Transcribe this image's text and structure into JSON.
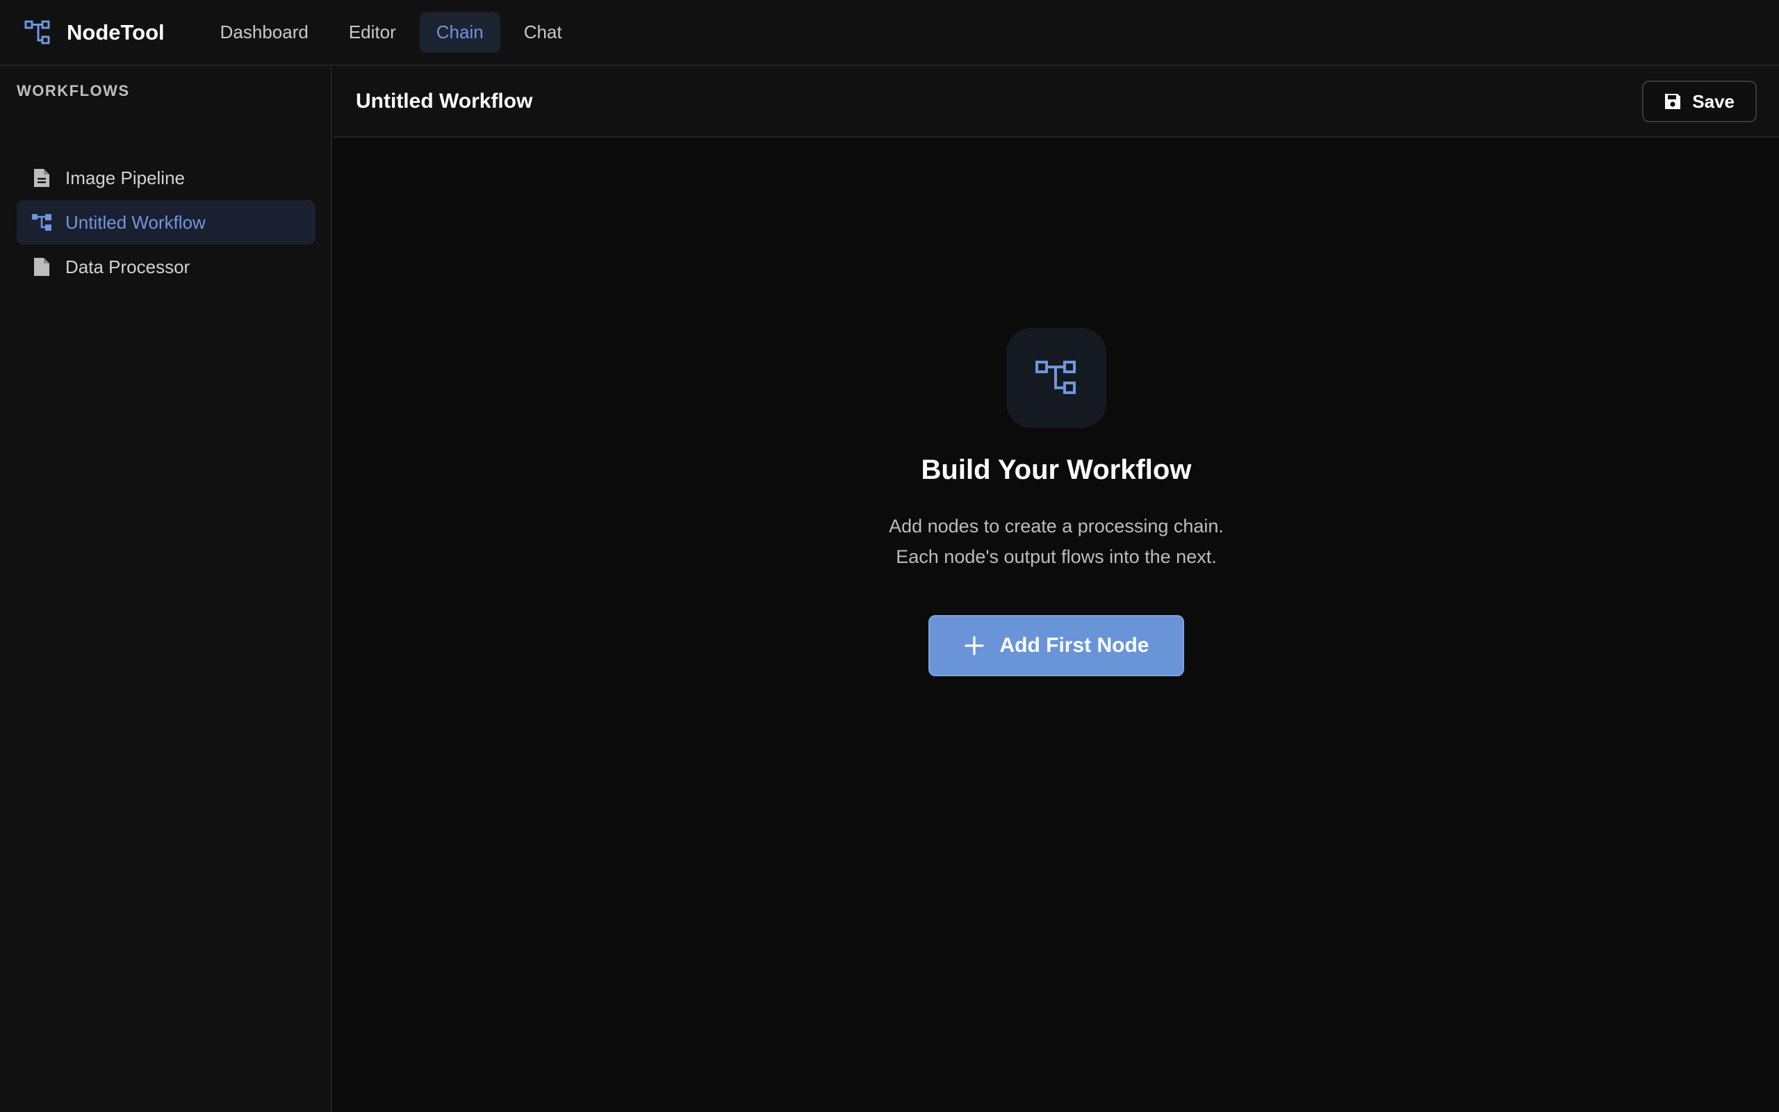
{
  "app": {
    "name": "NodeTool"
  },
  "nav": [
    {
      "label": "Dashboard",
      "active": false
    },
    {
      "label": "Editor",
      "active": false
    },
    {
      "label": "Chain",
      "active": true
    },
    {
      "label": "Chat",
      "active": false
    }
  ],
  "sidebar": {
    "section_title": "WORKFLOWS",
    "items": [
      {
        "label": "Image Pipeline",
        "icon": "file-text-icon",
        "active": false
      },
      {
        "label": "Untitled Workflow",
        "icon": "workflow-icon",
        "active": true
      },
      {
        "label": "Data Processor",
        "icon": "file-icon",
        "active": false
      }
    ]
  },
  "main": {
    "title": "Untitled Workflow",
    "save_label": "Save"
  },
  "empty_state": {
    "title": "Build Your Workflow",
    "line1": "Add nodes to create a processing chain.",
    "line2": "Each node's output flows into the next.",
    "button_label": "Add First Node"
  },
  "colors": {
    "accent": "#6a94d8",
    "background": "#0b0b0b",
    "panel": "#111111",
    "active_bg": "#1a2030"
  }
}
